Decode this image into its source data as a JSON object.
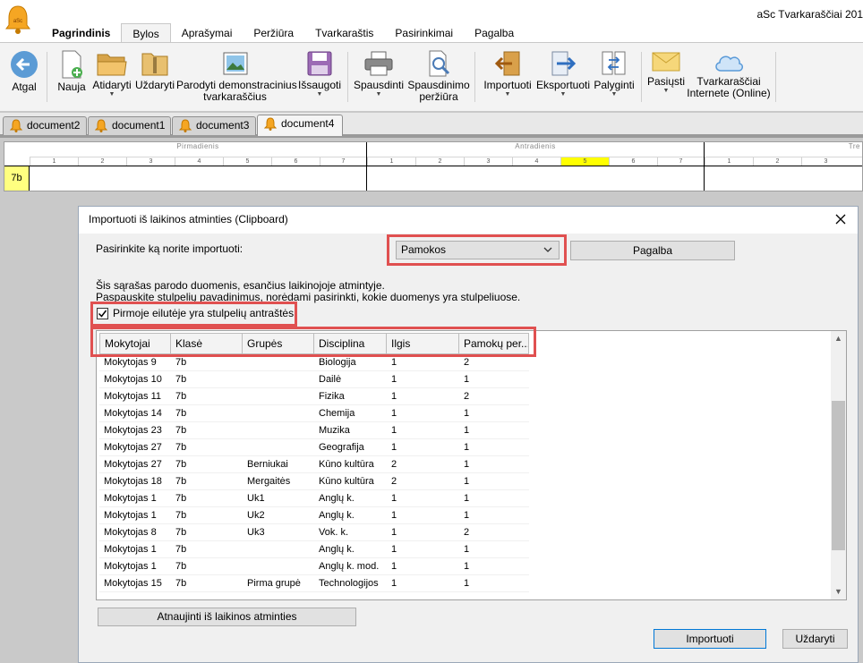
{
  "app": {
    "title": "aSc Tvarkaraščiai 201",
    "tabs": [
      "Pagrindinis",
      "Bylos",
      "Aprašymai",
      "Peržiūra",
      "Tvarkaraštis",
      "Pasirinkimai",
      "Pagalba"
    ],
    "active_tab": "Bylos"
  },
  "ribbon": {
    "back": "Atgal",
    "new": "Nauja",
    "open": "Atidaryti",
    "close": "Uždaryti",
    "demo_line1": "Parodyti demonstracinius",
    "demo_line2": "tvarkaraščius",
    "save": "Išsaugoti",
    "print": "Spausdinti",
    "preview_line1": "Spausdinimo",
    "preview_line2": "peržiūra",
    "import": "Importuoti",
    "export": "Eksportuoti",
    "compare": "Palyginti",
    "send": "Pasiųsti",
    "online_line1": "Tvarkaraščiai",
    "online_line2": "Internete (Online)"
  },
  "documents": [
    "document2",
    "document1",
    "document3",
    "document4"
  ],
  "active_document": "document4",
  "timetable": {
    "days": [
      "Pirmadienis",
      "Antradienis",
      "Tre"
    ],
    "periods": [
      "1",
      "2",
      "3",
      "4",
      "5",
      "6",
      "7"
    ],
    "class_name": "7b"
  },
  "dialog": {
    "title": "Importuoti iš laikinos atminties (Clipboard)",
    "choose_label": "Pasirinkite ką norite importuoti:",
    "selected_type": "Pamokos",
    "help_button": "Pagalba",
    "info_line1": "Šis sąrašas parodo duomenis, esančius laikinojoje atmintyje.",
    "info_line2": "Paspauskite stulpelių pavadinimus, norėdami pasirinkti, kokie duomenys yra stulpeliuose.",
    "header_checkbox_label": "Pirmoje eilutėje yra stulpelių antraštės",
    "header_checkbox_checked": true,
    "columns": [
      "Mokytojai",
      "Klasė",
      "Grupės",
      "Disciplina",
      "Ilgis",
      "Pamokų per..."
    ],
    "rows": [
      [
        "Mokytojas 9",
        "7b",
        "",
        "Biologija",
        "1",
        "2"
      ],
      [
        "Mokytojas 10",
        "7b",
        "",
        "Dailė",
        "1",
        "1"
      ],
      [
        "Mokytojas 11",
        "7b",
        "",
        "Fizika",
        "1",
        "2"
      ],
      [
        "Mokytojas 14",
        "7b",
        "",
        "Chemija",
        "1",
        "1"
      ],
      [
        "Mokytojas 23",
        "7b",
        "",
        "Muzika",
        "1",
        "1"
      ],
      [
        "Mokytojas 27",
        "7b",
        "",
        "Geografija",
        "1",
        "1"
      ],
      [
        "Mokytojas 27",
        "7b",
        "Berniukai",
        "Kūno kultūra",
        "2",
        "1"
      ],
      [
        "Mokytojas 18",
        "7b",
        "Mergaitės",
        "Kūno kultūra",
        "2",
        "1"
      ],
      [
        "Mokytojas 1",
        "7b",
        "Uk1",
        "Anglų k.",
        "1",
        "1"
      ],
      [
        "Mokytojas 1",
        "7b",
        "Uk2",
        "Anglų k.",
        "1",
        "1"
      ],
      [
        "Mokytojas 8",
        "7b",
        "Uk3",
        "Vok. k.",
        "1",
        "2"
      ],
      [
        "Mokytojas 1",
        "7b",
        "",
        "Anglų k.",
        "1",
        "1"
      ],
      [
        "Mokytojas 1",
        "7b",
        "",
        "Anglų k. mod.",
        "1",
        "1"
      ],
      [
        "Mokytojas 15",
        "7b",
        "Pirma grupė",
        "Technologijos",
        "1",
        "1"
      ]
    ],
    "refresh_button": "Atnaujinti iš laikinos atminties",
    "import_button": "Importuoti",
    "close_button": "Uždaryti"
  }
}
